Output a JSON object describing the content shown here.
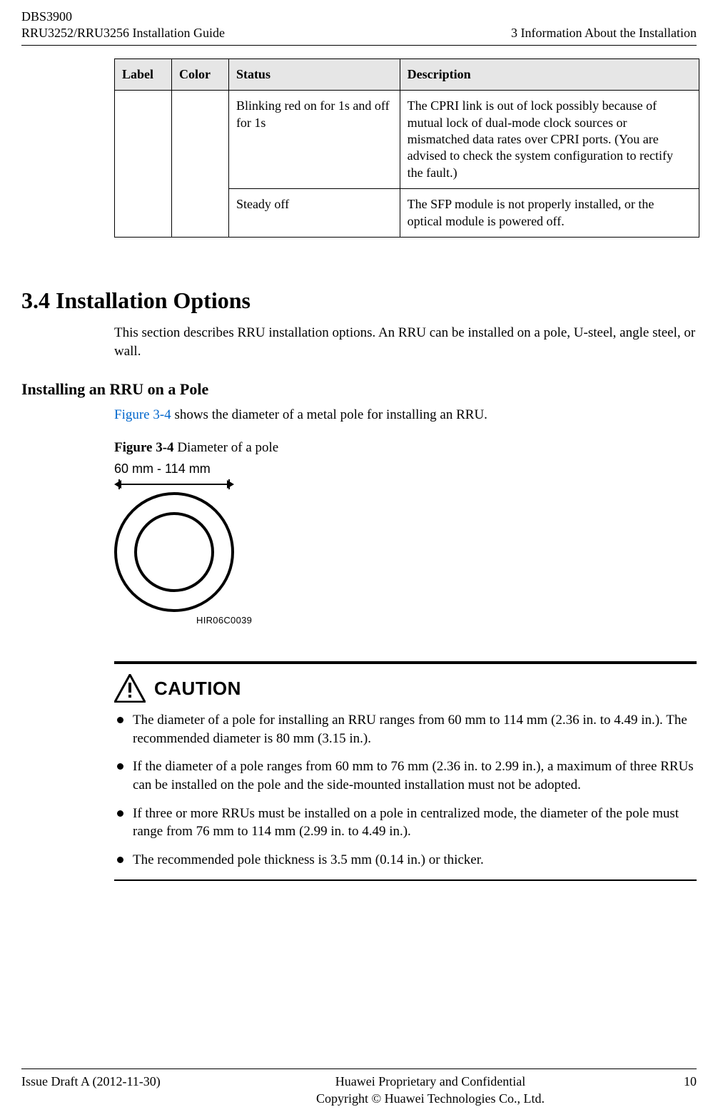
{
  "header": {
    "left_line1": "DBS3900",
    "left_line2": "RRU3252/RRU3256 Installation Guide",
    "right_line2": "3 Information About the Installation"
  },
  "table": {
    "headers": {
      "label": "Label",
      "color": "Color",
      "status": "Status",
      "description": "Description"
    },
    "rows": [
      {
        "label": "",
        "color": "",
        "status": "Blinking red on for 1s and off for 1s",
        "description": "The CPRI link is out of lock possibly because of mutual lock of dual-mode clock sources or mismatched data rates over CPRI ports. (You are advised to check the system configuration to rectify the fault.)"
      },
      {
        "status": "Steady off",
        "description": "The SFP module is not properly installed, or the optical module is powered off."
      }
    ]
  },
  "section": {
    "heading": "3.4 Installation Options",
    "intro": "This section describes RRU installation options. An RRU can be installed on a pole, U-steel, angle steel, or wall."
  },
  "subsection": {
    "heading": "Installing an RRU on a Pole",
    "ref_link": "Figure 3-4",
    "ref_rest": " shows the diameter of a metal pole for installing an RRU."
  },
  "figure": {
    "caption_bold": "Figure 3-4",
    "caption_rest": " Diameter of a pole",
    "dim_label": "60 mm - 114 mm",
    "code": "HIR06C0039"
  },
  "caution": {
    "label": "CAUTION",
    "items": [
      "The diameter of a pole for installing an RRU ranges from 60 mm to 114 mm (2.36 in. to 4.49 in.). The recommended diameter is 80 mm (3.15 in.).",
      "If the diameter of a pole ranges from 60 mm to 76 mm (2.36 in. to 2.99 in.), a maximum of three RRUs can be installed on the pole and the side-mounted installation must not be adopted.",
      "If three or more RRUs must be installed on a pole in centralized mode, the diameter of the pole must range from 76 mm to 114 mm (2.99 in. to 4.49 in.).",
      "The recommended pole thickness is 3.5 mm (0.14 in.) or thicker."
    ]
  },
  "footer": {
    "left": "Issue Draft A (2012-11-30)",
    "center_line1": "Huawei Proprietary and Confidential",
    "center_line2": "Copyright © Huawei Technologies Co., Ltd.",
    "right": "10"
  }
}
